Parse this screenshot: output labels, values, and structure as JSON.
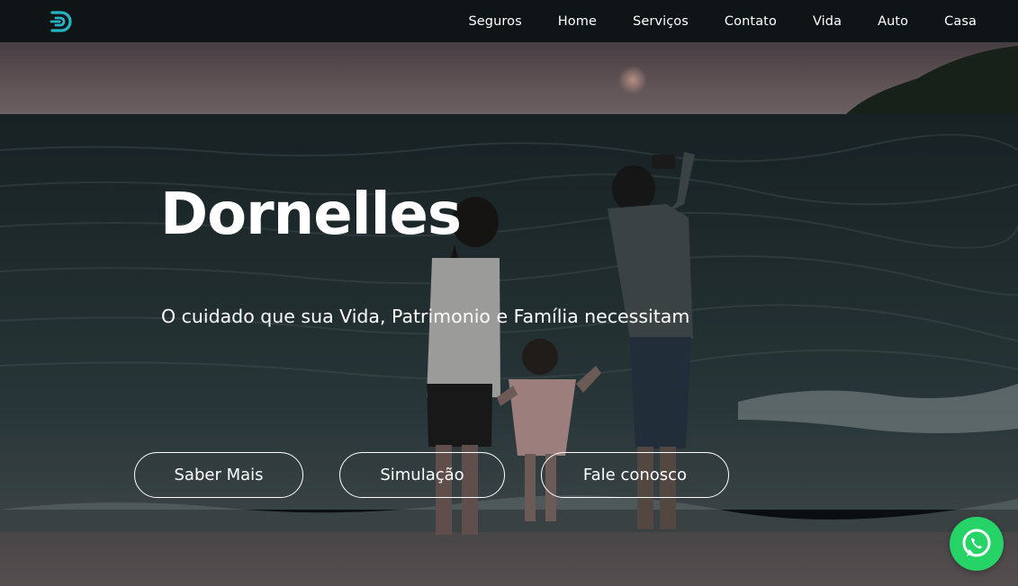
{
  "brand": {
    "logo_icon": "dornelles-logo-icon",
    "accent": "#27b4c2"
  },
  "nav": {
    "items": [
      {
        "label": "Seguros"
      },
      {
        "label": "Home"
      },
      {
        "label": "Serviços"
      },
      {
        "label": "Contato"
      },
      {
        "label": "Vida"
      },
      {
        "label": "Auto"
      },
      {
        "label": "Casa"
      }
    ]
  },
  "hero": {
    "title": "Dornelles",
    "subtitle": "O cuidado que sua Vida, Patrimonio e Família necessitam",
    "buttons": [
      {
        "label": "Saber Mais"
      },
      {
        "label": "Simulação"
      },
      {
        "label": "Fale conosco"
      }
    ]
  },
  "whatsapp": {
    "icon": "whatsapp-icon",
    "color": "#25d366"
  }
}
